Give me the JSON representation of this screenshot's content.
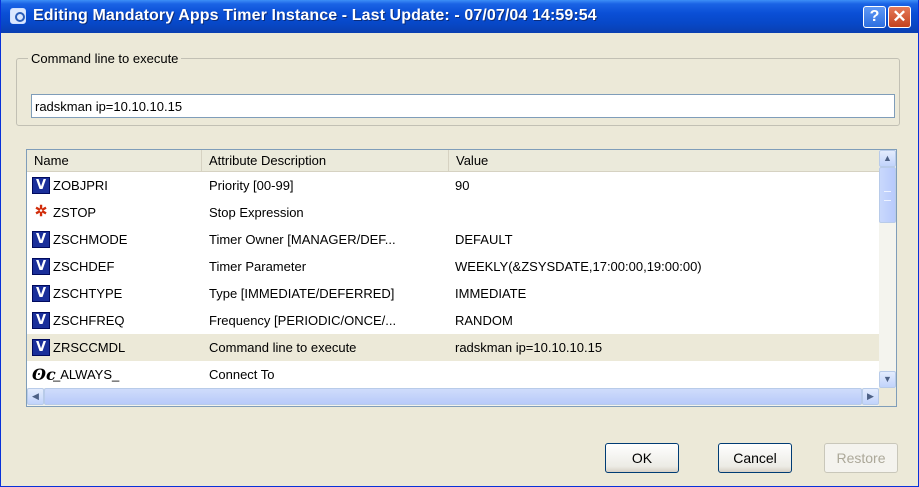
{
  "window": {
    "title": "Editing Mandatory Apps Timer Instance - Last Update: - 07/07/04 14:59:54",
    "help_glyph": "?",
    "close_glyph": "✕"
  },
  "command_group": {
    "legend": "Command line to execute",
    "value": "radskman ip=10.10.10.15"
  },
  "table": {
    "columns": [
      "Name",
      "Attribute Description",
      "Value"
    ],
    "rows": [
      {
        "icon": "variable-icon",
        "name": "ZOBJPRI",
        "attr": "Priority [00-99]",
        "value": "90"
      },
      {
        "icon": "stop-expression-icon",
        "name": "ZSTOP",
        "attr": "Stop Expression",
        "value": ""
      },
      {
        "icon": "variable-icon",
        "name": "ZSCHMODE",
        "attr": "Timer Owner [MANAGER/DEF...",
        "value": "DEFAULT"
      },
      {
        "icon": "variable-icon",
        "name": "ZSCHDEF",
        "attr": "Timer Parameter",
        "value": "WEEKLY(&ZSYSDATE,17:00:00,19:00:00)"
      },
      {
        "icon": "variable-icon",
        "name": "ZSCHTYPE",
        "attr": "Type [IMMEDIATE/DEFERRED]",
        "value": "IMMEDIATE"
      },
      {
        "icon": "variable-icon",
        "name": "ZSCHFREQ",
        "attr": "Frequency [PERIODIC/ONCE/...",
        "value": "RANDOM"
      },
      {
        "icon": "variable-icon",
        "name": "ZRSCCMDL",
        "attr": "Command line to execute",
        "value": "radskman ip=10.10.10.15",
        "selected": true
      },
      {
        "icon": "connection-icon",
        "name": "_ALWAYS_",
        "attr": "Connect To",
        "value": ""
      }
    ]
  },
  "buttons": {
    "ok": "OK",
    "cancel": "Cancel",
    "restore": "Restore"
  },
  "icon_glyphs": {
    "variable-icon": "V",
    "stop-expression-icon": "✲",
    "connection-icon": "ʘc"
  },
  "colors": {
    "titlebar": "#0a4fd6",
    "selected_row": "#ece9d8",
    "variable_icon_bg": "#1a2f9a",
    "stop_icon": "#d12c0a"
  }
}
